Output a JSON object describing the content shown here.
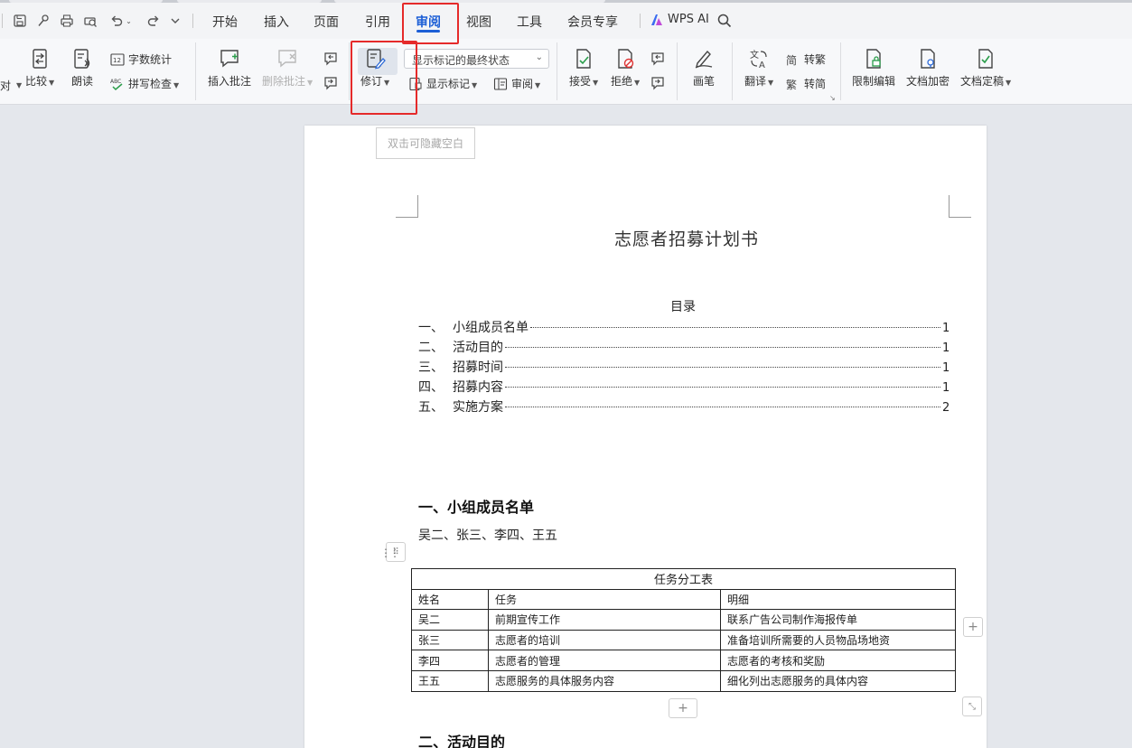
{
  "menubar": {
    "tabs": [
      "开始",
      "插入",
      "页面",
      "引用",
      "审阅",
      "视图",
      "工具",
      "会员专享"
    ],
    "active_tab": "审阅",
    "wps_ai": "WPS AI"
  },
  "ribbon": {
    "partial_left": "对",
    "compare": "比较",
    "read_aloud": "朗读",
    "word_count": "字数统计",
    "spell_check": "拼写检查",
    "insert_comment": "插入批注",
    "delete_comment": "删除批注",
    "revise": "修订",
    "markup_state": "显示标记的最终状态",
    "show_markup": "显示标记",
    "review": "审阅",
    "accept": "接受",
    "reject": "拒绝",
    "pen": "画笔",
    "translate": "翻译",
    "to_traditional": "转繁",
    "to_simplified": "转简",
    "restrict_edit": "限制编辑",
    "encrypt_doc": "文档加密",
    "finalize_doc": "文档定稿"
  },
  "document": {
    "hide_blank": "双击可隐藏空白",
    "title": "志愿者招募计划书",
    "toc_title": "目录",
    "toc": [
      {
        "num": "一、",
        "text": "小组成员名单",
        "page": "1"
      },
      {
        "num": "二、",
        "text": "活动目的",
        "page": "1"
      },
      {
        "num": "三、",
        "text": "招募时间",
        "page": "1"
      },
      {
        "num": "四、",
        "text": "招募内容",
        "page": "1"
      },
      {
        "num": "五、",
        "text": "实施方案",
        "page": "2"
      }
    ],
    "section1_heading": "一、小组成员名单",
    "members": "吴二、张三、李四、王五",
    "table": {
      "caption": "任务分工表",
      "headers": [
        "姓名",
        "任务",
        "明细"
      ],
      "rows": [
        [
          "吴二",
          "前期宣传工作",
          "联系广告公司制作海报传单"
        ],
        [
          "张三",
          "志愿者的培训",
          "准备培训所需要的人员物品场地资"
        ],
        [
          "李四",
          "志愿者的管理",
          "志愿者的考核和奖励"
        ],
        [
          "王五",
          "志愿服务的具体服务内容",
          "细化列出志愿服务的具体内容"
        ]
      ]
    },
    "section2_heading": "二、活动目的"
  },
  "colors": {
    "accent": "#1d5fd6",
    "highlight": "#e52a2a"
  }
}
